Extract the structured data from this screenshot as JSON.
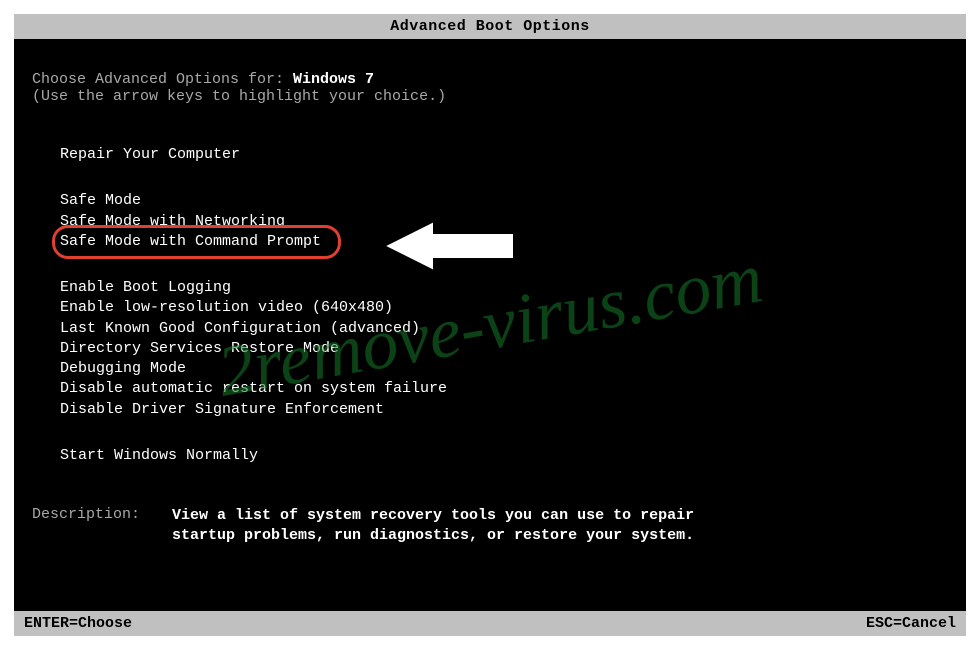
{
  "title": "Advanced Boot Options",
  "intro": {
    "prefix": "Choose Advanced Options for: ",
    "os": "Windows 7",
    "hint": "(Use the arrow keys to highlight your choice.)"
  },
  "options": {
    "repair": "Repair Your Computer",
    "safe_mode": "Safe Mode",
    "safe_mode_net": "Safe Mode with Networking",
    "safe_mode_cmd": "Safe Mode with Command Prompt",
    "boot_logging": "Enable Boot Logging",
    "low_res": "Enable low-resolution video (640x480)",
    "last_known": "Last Known Good Configuration (advanced)",
    "ds_restore": "Directory Services Restore Mode",
    "debugging": "Debugging Mode",
    "disable_restart": "Disable automatic restart on system failure",
    "disable_sig": "Disable Driver Signature Enforcement",
    "start_normal": "Start Windows Normally"
  },
  "description": {
    "label": "Description:",
    "text": "View a list of system recovery tools you can use to repair startup problems, run diagnostics, or restore your system."
  },
  "footer": {
    "enter": "ENTER=Choose",
    "esc": "ESC=Cancel"
  },
  "watermark": "2remove-virus.com"
}
